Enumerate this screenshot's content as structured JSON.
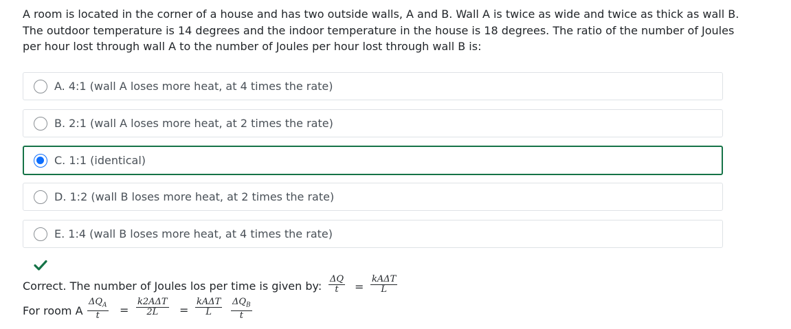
{
  "question": {
    "text": "A room is located in the corner of a house and has two outside walls, A and B. Wall A is twice as wide and twice as thick as wall B. The outdoor temperature is 14 degrees and the indoor temperature in the house is 18 degrees. The ratio of the number of Joules per hour lost through wall A to the number of Joules per hour lost through wall B is:"
  },
  "options": [
    {
      "label": "A. 4:1 (wall A loses more heat, at 4 times the rate)",
      "selected": false
    },
    {
      "label": "B. 2:1 (wall A loses more heat, at 2 times the rate)",
      "selected": false
    },
    {
      "label": "C. 1:1 (identical)",
      "selected": true
    },
    {
      "label": "D. 1:2 (wall B loses more heat, at 2 times the rate)",
      "selected": false
    },
    {
      "label": "E. 1:4 (wall B loses more heat, at 4 times the rate)",
      "selected": false
    }
  ],
  "feedback": {
    "status_icon": "check-icon",
    "status_color": "#157347",
    "line1_text": "Correct. The number of Joules los per time is given by:",
    "line2_text": "For room A",
    "formula1": {
      "lhs_num": "ΔQ",
      "lhs_den": "t",
      "eq": "=",
      "rhs_num": "kAΔT",
      "rhs_den": "L"
    },
    "formula2": {
      "lhs_num": "ΔQ",
      "lhs_sub": "A",
      "lhs_den": "t",
      "eq1": "=",
      "mid_num": "k2AΔT",
      "mid_den": "2L",
      "eq2": "=",
      "rhs_num": "kAΔT",
      "rhs_den": "L",
      "last_num": "ΔQ",
      "last_sub": "B",
      "last_den": "t"
    }
  },
  "colors": {
    "selected_border": "#157347",
    "radio_checked": "#0d6efd"
  }
}
